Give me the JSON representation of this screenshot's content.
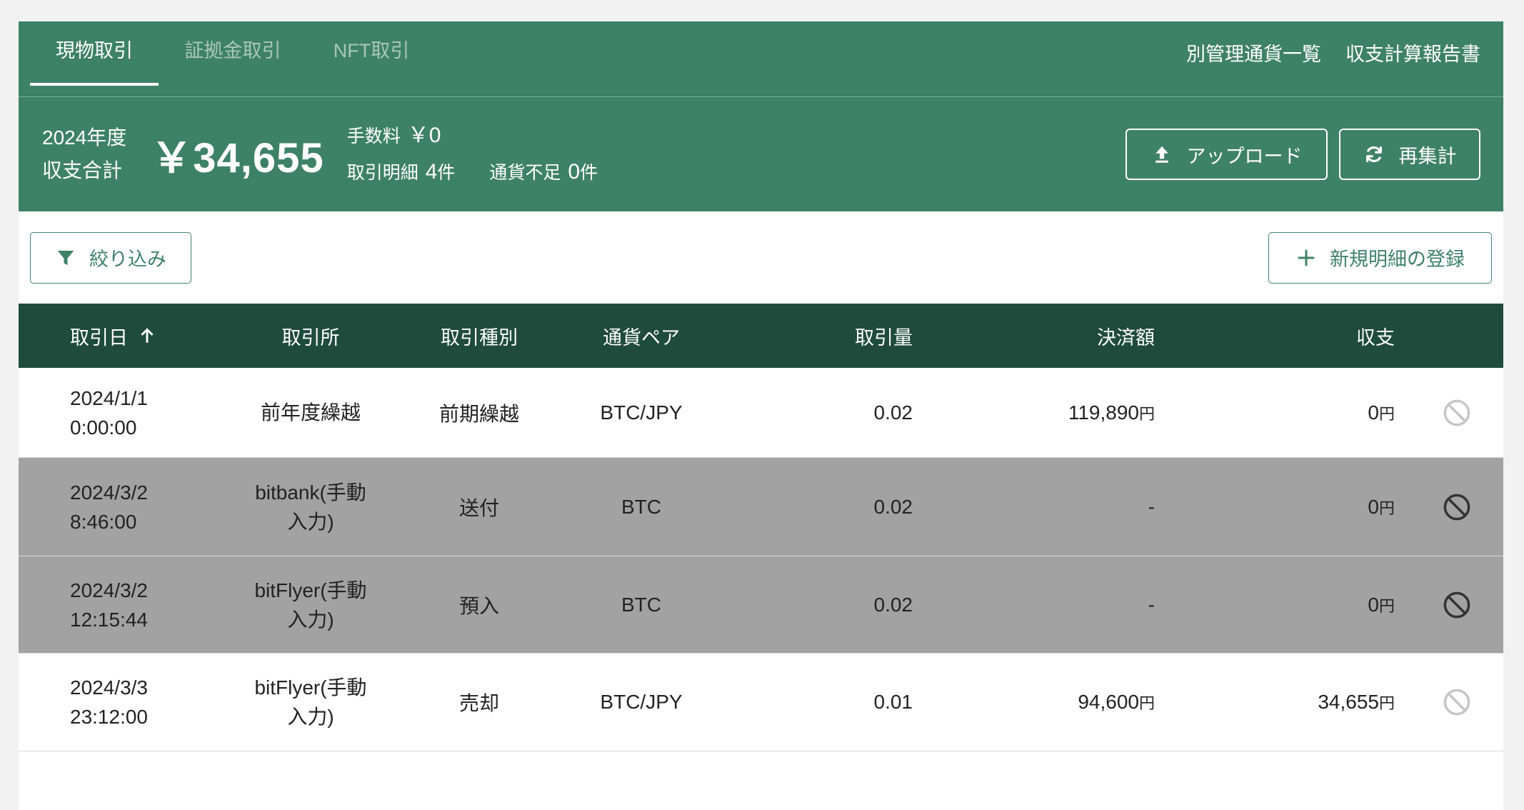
{
  "tabs": {
    "items": [
      {
        "label": "現物取引",
        "active": true
      },
      {
        "label": "証拠金取引",
        "active": false
      },
      {
        "label": "NFT取引",
        "active": false
      }
    ],
    "links": [
      "別管理通貨一覧",
      "収支計算報告書"
    ]
  },
  "summary": {
    "year_label": "2024年度",
    "total_label": "収支合計",
    "total_amount": "￥34,655",
    "fee_label": "手数料",
    "fee_value": "￥0",
    "detail_label": "取引明細",
    "detail_count": "4",
    "count_unit": "件",
    "shortage_label": "通貨不足",
    "shortage_count": "0"
  },
  "actions": {
    "upload": "アップロード",
    "recalc": "再集計",
    "filter": "絞り込み",
    "new_entry": "新規明細の登録"
  },
  "icons": {
    "upload": "upload-icon",
    "recalc": "refresh-icon",
    "filter": "filter-icon",
    "new_entry": "plus-icon",
    "sort": "arrow-up-icon",
    "row_action": "ban-icon"
  },
  "table": {
    "columns": [
      "取引日",
      "取引所",
      "取引種別",
      "通貨ペア",
      "取引量",
      "決済額",
      "収支"
    ],
    "sort_column": "取引日",
    "sort_direction": "ascending",
    "rows": [
      {
        "date": "2024/1/1",
        "time": "0:00:00",
        "exchange_lines": [
          "前年度繰越"
        ],
        "type": "前期繰越",
        "pair": "BTC/JPY",
        "amount": "0.02",
        "settlement": "119,890",
        "settlement_unit": "円",
        "pnl": "0",
        "pnl_unit": "円",
        "row_bg": "#ffffff"
      },
      {
        "date": "2024/3/2",
        "time": "8:46:00",
        "exchange_lines": [
          "bitbank(手動",
          "入力)"
        ],
        "type": "送付",
        "pair": "BTC",
        "amount": "0.02",
        "settlement": "-",
        "settlement_unit": "",
        "pnl": "0",
        "pnl_unit": "円",
        "row_bg": "#a2a2a2"
      },
      {
        "date": "2024/3/2",
        "time": "12:15:44",
        "exchange_lines": [
          "bitFlyer(手動",
          "入力)"
        ],
        "type": "預入",
        "pair": "BTC",
        "amount": "0.02",
        "settlement": "-",
        "settlement_unit": "",
        "pnl": "0",
        "pnl_unit": "円",
        "row_bg": "#a2a2a2"
      },
      {
        "date": "2024/3/3",
        "time": "23:12:00",
        "exchange_lines": [
          "bitFlyer(手動",
          "入力)"
        ],
        "type": "売却",
        "pair": "BTC/JPY",
        "amount": "0.01",
        "settlement": "94,600",
        "settlement_unit": "円",
        "pnl": "34,655",
        "pnl_unit": "円",
        "row_bg": "#ffffff"
      }
    ]
  },
  "colors": {
    "brand_green": "#3e8169",
    "header_dark_green": "#1f4b3d",
    "excluded_row_gray": "#a2a2a2"
  }
}
